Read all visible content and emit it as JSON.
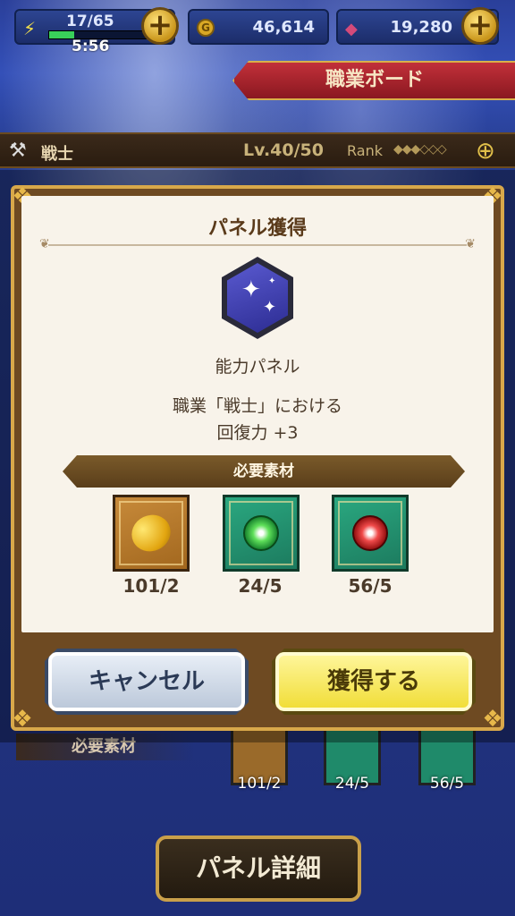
{
  "status": {
    "stamina": "17/65",
    "stamina_fill": 0.26,
    "stamina_timer": "5:56",
    "gold": "46,614",
    "gems": "19,280",
    "plus_label": "+"
  },
  "banner": {
    "title": "職業ボード"
  },
  "job": {
    "name": "戦士",
    "level": "Lv.40/50",
    "rank_label": "Rank",
    "rank_marks": "◆◆◆◇◇◇"
  },
  "modal": {
    "title": "パネル獲得",
    "panel_name": "能力パネル",
    "effect_line1": "職業「戦士」における",
    "effect_line2": "回復力 +3",
    "required_label": "必要素材",
    "materials": [
      {
        "icon": "golden-fruit-icon",
        "count": "101/2"
      },
      {
        "icon": "green-orb-icon",
        "count": "24/5"
      },
      {
        "icon": "red-orb-icon",
        "count": "56/5"
      }
    ],
    "cancel_label": "キャンセル",
    "acquire_label": "獲得する"
  },
  "background": {
    "required_label": "必要素材",
    "counts": [
      "101/2",
      "24/5",
      "56/5"
    ],
    "detail_label": "パネル詳細"
  },
  "colors": {
    "modal_frame": "#d8a84a",
    "acquire_button": "#f0dc32",
    "cancel_button": "#b9c6d8",
    "banner_red": "#c2303a"
  }
}
